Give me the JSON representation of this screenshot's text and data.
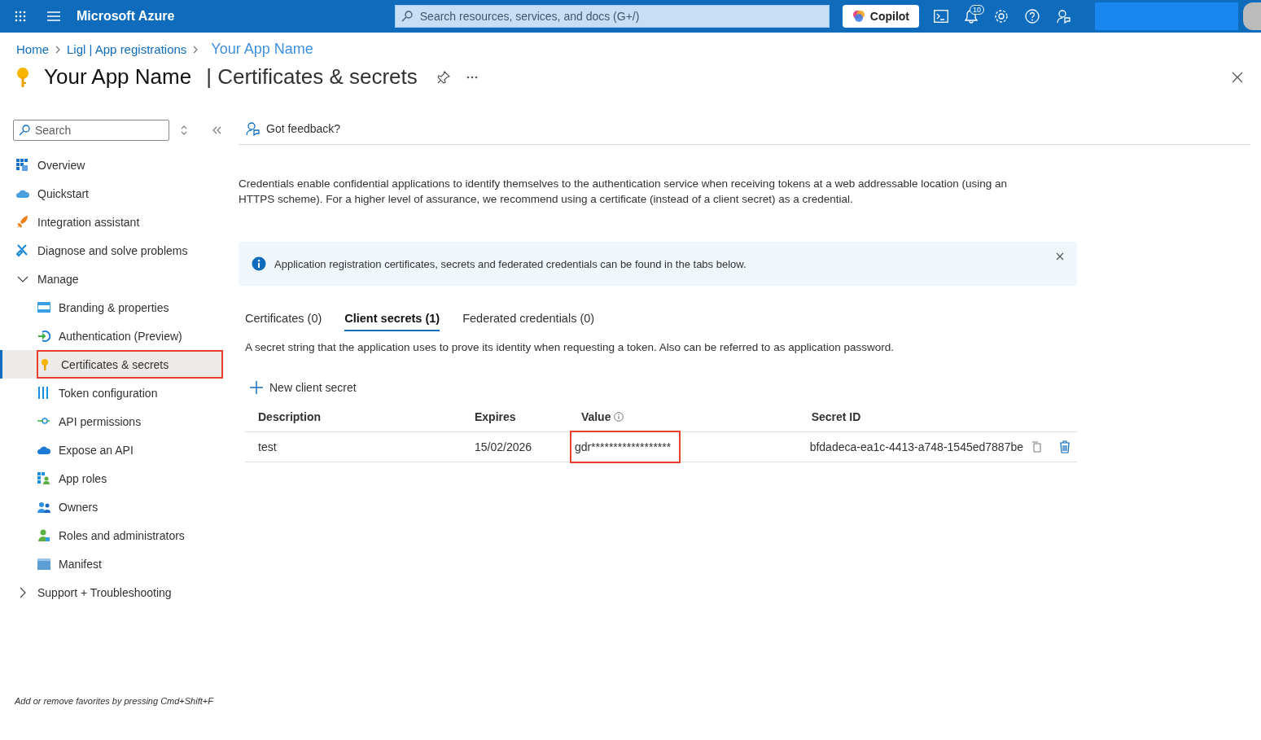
{
  "topbar": {
    "brand": "Microsoft Azure",
    "search_placeholder": "Search resources, services, and docs (G+/)",
    "copilot": "Copilot",
    "notification_count": "10"
  },
  "breadcrumb": [
    {
      "label": "Home"
    },
    {
      "label": "Ligl | App registrations"
    },
    {
      "label": "Your App Name"
    }
  ],
  "page": {
    "title": "Your App Name",
    "subtitle": "| Certificates & secrets"
  },
  "sidebar": {
    "search_placeholder": "Search",
    "items": [
      {
        "kind": "link",
        "label": "Overview",
        "selected": false
      },
      {
        "kind": "link",
        "label": "Quickstart",
        "selected": false
      },
      {
        "kind": "link",
        "label": "Integration assistant",
        "selected": false
      },
      {
        "kind": "link",
        "label": "Diagnose and solve problems",
        "selected": false
      },
      {
        "kind": "group",
        "label": "Manage",
        "expanded": true,
        "children": [
          {
            "label": "Branding & properties",
            "selected": false,
            "highlighted": false
          },
          {
            "label": "Authentication (Preview)",
            "selected": false,
            "highlighted": false
          },
          {
            "label": "Certificates & secrets",
            "selected": true,
            "highlighted": true
          },
          {
            "label": "Token configuration",
            "selected": false,
            "highlighted": false
          },
          {
            "label": "API permissions",
            "selected": false,
            "highlighted": false
          },
          {
            "label": "Expose an API",
            "selected": false,
            "highlighted": false
          },
          {
            "label": "App roles",
            "selected": false,
            "highlighted": false
          },
          {
            "label": "Owners",
            "selected": false,
            "highlighted": false
          },
          {
            "label": "Roles and administrators",
            "selected": false,
            "highlighted": false
          },
          {
            "label": "Manifest",
            "selected": false,
            "highlighted": false
          }
        ]
      },
      {
        "kind": "group",
        "label": "Support + Troubleshooting",
        "expanded": false
      }
    ],
    "footer": "Add or remove favorites by pressing Cmd+Shift+F"
  },
  "content": {
    "feedback": "Got feedback?",
    "description": "Credentials enable confidential applications to identify themselves to the authentication service when receiving tokens at a web addressable location (using an HTTPS scheme). For a higher level of assurance, we recommend using a certificate (instead of a client secret) as a credential.",
    "info_banner": "Application registration certificates, secrets and federated credentials can be found in the tabs below.",
    "tabs": [
      {
        "label": "Certificates (0)",
        "selected": false
      },
      {
        "label": "Client secrets (1)",
        "selected": true
      },
      {
        "label": "Federated credentials (0)",
        "selected": false
      }
    ],
    "tab_description": "A secret string that the application uses to prove its identity when requesting a token. Also can be referred to as application password.",
    "new_button": "New client secret",
    "table": {
      "columns": [
        "Description",
        "Expires",
        "Value",
        "Secret ID"
      ],
      "rows": [
        {
          "description": "test",
          "expires": "15/02/2026",
          "value": "gdr******************",
          "value_highlighted": true,
          "secret_id": "bfdadeca-ea1c-4413-a748-1545ed7887be"
        }
      ]
    }
  }
}
